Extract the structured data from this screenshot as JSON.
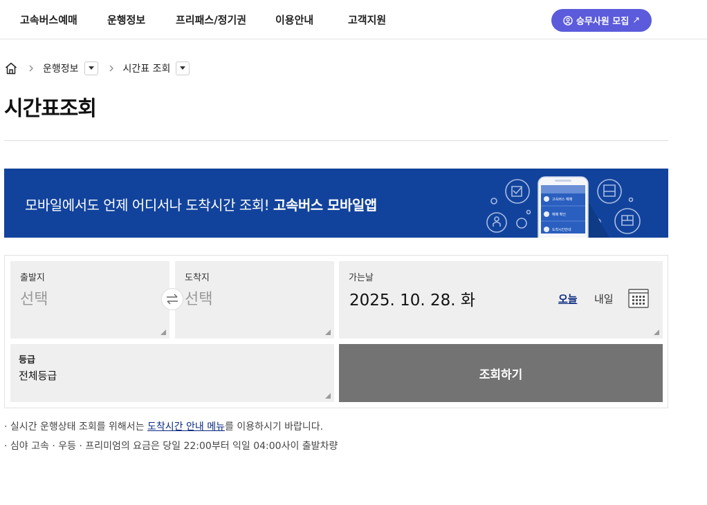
{
  "nav": {
    "items": [
      "고속버스예매",
      "운행정보",
      "프리패스/정기권",
      "이용안내",
      "고객지원"
    ],
    "recruit_button": "승무사원 모집",
    "recruit_arrow": "↗"
  },
  "breadcrumb": {
    "home_icon": "home-icon",
    "level1": "운행정보",
    "level2": "시간표 조회"
  },
  "page_title": "시간표조회",
  "banner": {
    "text": "모바일에서도 언제 어디서나 도착시간 조회!",
    "highlight": "고속버스 모바일앱",
    "phone_menu": [
      "고속버스 예매",
      "예매 확인",
      "도착시간안내"
    ]
  },
  "search": {
    "departure": {
      "label": "출발지",
      "value": "선택"
    },
    "arrival": {
      "label": "도착지",
      "value": "선택"
    },
    "swap_symbol": "⇄",
    "date": {
      "label": "가는날",
      "value": "2025. 10. 28. 화",
      "today": "오늘",
      "tomorrow": "내일"
    },
    "grade": {
      "label": "등급",
      "value": "전체등급"
    },
    "submit": "조회하기"
  },
  "notes": {
    "line1_prefix": "· 실시간 운행상태 조회를 위해서는 ",
    "line1_link": "도착시간 안내 메뉴",
    "line1_suffix": "를 이용하시기 바랍니다.",
    "line2": "· 심야 고속 · 우등 · 프리미엄의 요금은 당일 22:00부터 익일 04:00사이 출발차량"
  },
  "colors": {
    "primary": "#5b5bdb",
    "banner": "#12439c",
    "submit": "#737373",
    "link": "#0a2a80"
  }
}
